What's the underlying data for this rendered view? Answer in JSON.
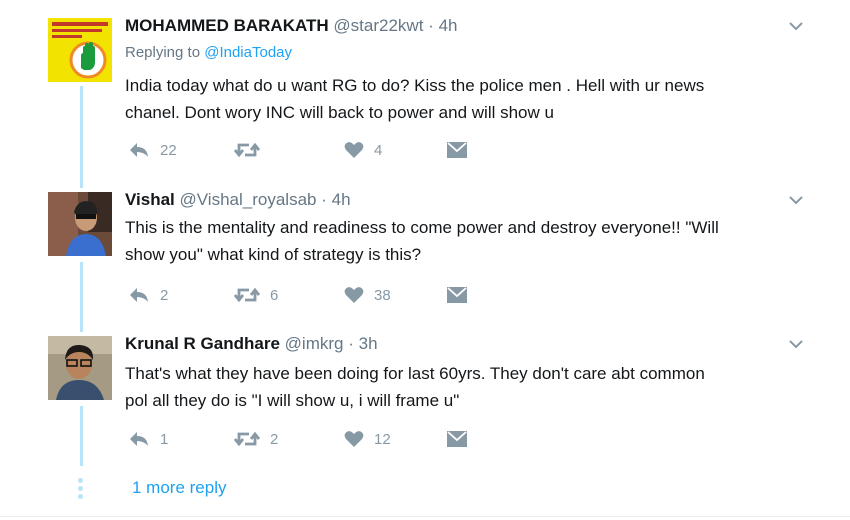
{
  "tweets": [
    {
      "name": "MOHAMMED BARAKATH",
      "handle": "@star22kwt",
      "time": "4h",
      "replying_label": "Replying to",
      "replying_to": "@IndiaToday",
      "text_lines": [
        "India today what do u want RG to do? Kiss the police men . Hell with ur news",
        "chanel. Dont wory  INC will back to power and will show u"
      ],
      "replies": "22",
      "retweets": "",
      "likes": "4",
      "avatar_icon": "congress-hand-logo"
    },
    {
      "name": "Vishal",
      "handle": "@Vishal_royalsab",
      "time": "4h",
      "text_lines": [
        "This is the mentality and readiness to come power and destroy everyone!! \"Will",
        "show you\" what kind of strategy is this?"
      ],
      "replies": "2",
      "retweets": "6",
      "likes": "38",
      "avatar_icon": "user-photo"
    },
    {
      "name": "Krunal R Gandhare",
      "handle": "@imkrg",
      "time": "3h",
      "text_lines": [
        "That's what they have been doing for last 60yrs. They don't care abt common",
        "pol all they do is \"I will show u, i will frame u\""
      ],
      "replies": "1",
      "retweets": "2",
      "likes": "12",
      "avatar_icon": "user-photo"
    }
  ],
  "more_reply": "1 more reply",
  "colors": {
    "accent": "#1da1f2",
    "icon": "#8899a6",
    "thread": "#b9e3f8",
    "muted": "#657786"
  }
}
